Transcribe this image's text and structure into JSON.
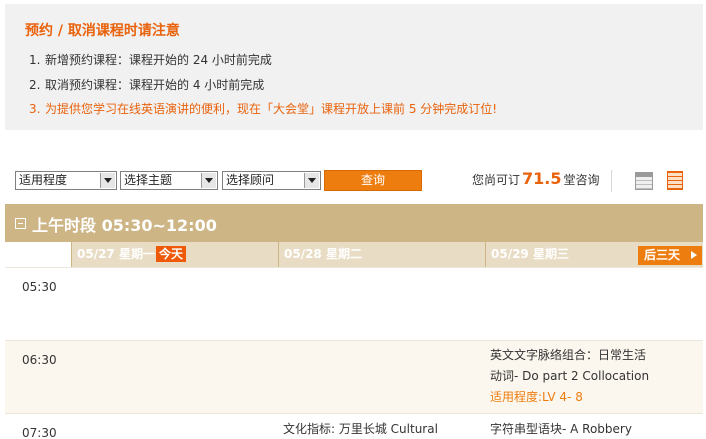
{
  "notice": {
    "title": "预约 / 取消课程时请注意",
    "items": [
      {
        "num": "1.",
        "text": "新增预约课程：课程开始的 24 小时前完成"
      },
      {
        "num": "2.",
        "text": "取消预约课程：课程开始的 4 小时前完成"
      },
      {
        "num": "3.",
        "text": "为提供您学习在线英语演讲的便利，现在「大会堂」课程开放上课前 5 分钟完成订位!"
      }
    ]
  },
  "toolbar": {
    "level_select": "适用程度",
    "topic_select": "选择主题",
    "consultant_select": "选择顾问",
    "query_label": "查询",
    "credit_prefix": "您尚可订",
    "credit_value": "71.5",
    "credit_suffix": "堂咨询"
  },
  "icons": {
    "calendar": "calendar-icon",
    "list": "list-icon"
  },
  "schedule": {
    "period_title": "上午时段 05:30~12:00",
    "days": [
      {
        "label": "05/27 星期一",
        "badge": "今天"
      },
      {
        "label": "05/28 星期二"
      },
      {
        "label": "05/29 星期三"
      }
    ],
    "next_label": "后三天",
    "rows": [
      {
        "time": "05:30"
      },
      {
        "time": "06:30",
        "day3": {
          "title": "英文文字脉络组合：日常生活",
          "subtitle": "动词- Do part 2 Collocation",
          "level": "适用程度:LV 4- 8"
        }
      },
      {
        "time": "07:30",
        "day2": {
          "title": "文化指标: 万里长城 Cultural"
        },
        "day3": {
          "title": "字符串型语块- A Robbery"
        }
      }
    ]
  },
  "colors": {
    "accent": "#ee7d10",
    "title_orange": "#e9620c",
    "band": "#cdb585",
    "day_header": "#e9dcc4"
  }
}
